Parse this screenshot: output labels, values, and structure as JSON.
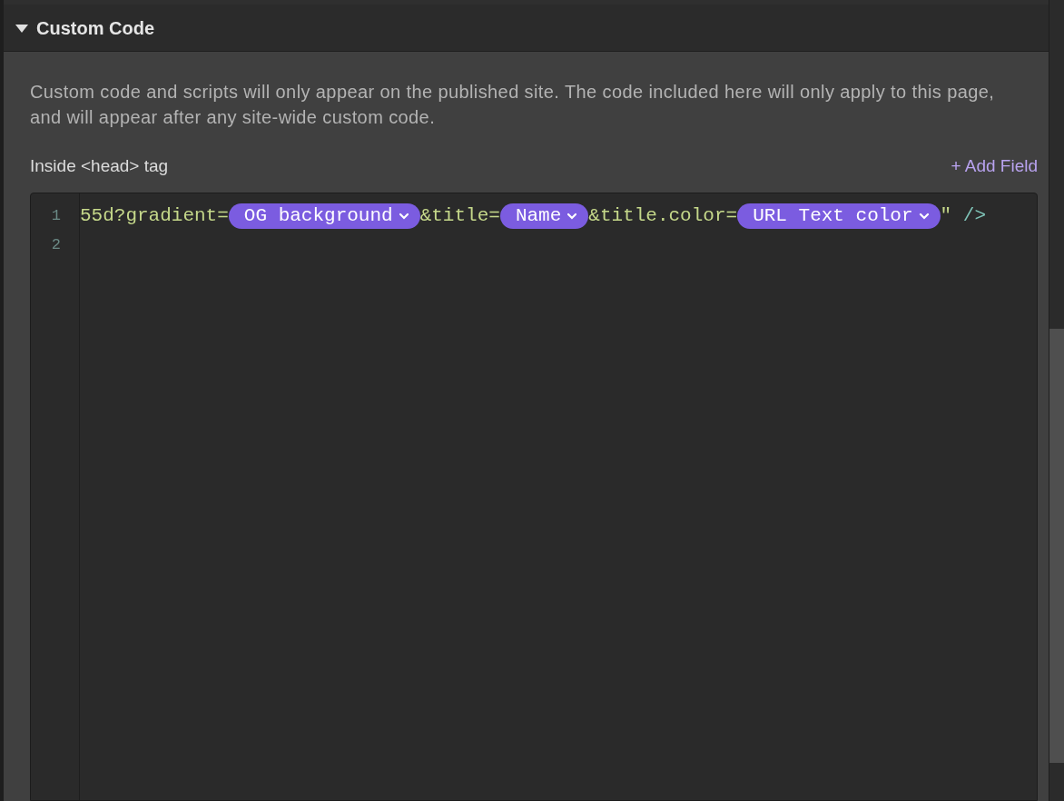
{
  "section": {
    "title": "Custom Code",
    "expanded": true
  },
  "description": "Custom code and scripts will only appear on the published site. The code included here will only apply to this page, and will appear after any site-wide custom code.",
  "field_label": "Inside <head> tag",
  "add_field": "+ Add Field",
  "editor": {
    "lines": [
      {
        "number": "1",
        "segments": [
          {
            "kind": "text",
            "text": "55d?gradient="
          },
          {
            "kind": "token",
            "text": "OG background"
          },
          {
            "kind": "text",
            "text": "&title="
          },
          {
            "kind": "token",
            "text": "Name"
          },
          {
            "kind": "text",
            "text": "&title.color="
          },
          {
            "kind": "token",
            "text": "URL Text color"
          },
          {
            "kind": "text",
            "text": "\""
          },
          {
            "kind": "tag",
            "text": " />"
          }
        ]
      },
      {
        "number": "2"
      }
    ]
  }
}
